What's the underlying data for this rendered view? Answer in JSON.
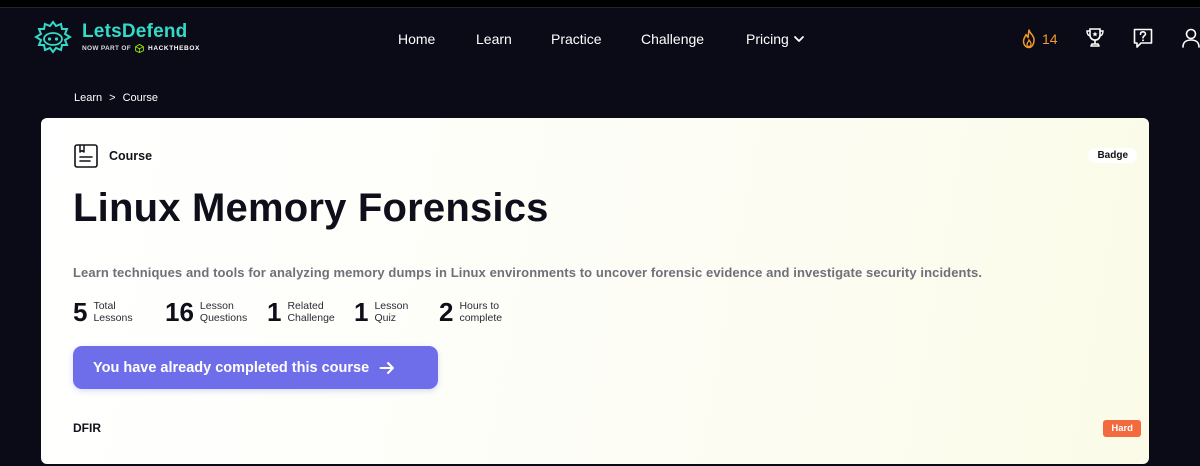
{
  "brand": {
    "name": "LetsDefend",
    "now_part_of": "NOW PART OF",
    "partner": "HACKTHEBOX",
    "color": "#34d9c8"
  },
  "nav": {
    "items": [
      {
        "label": "Home"
      },
      {
        "label": "Learn"
      },
      {
        "label": "Practice"
      },
      {
        "label": "Challenge"
      },
      {
        "label": "Pricing"
      }
    ]
  },
  "header": {
    "streak_count": "14",
    "streak_icon": "fire-icon",
    "icons": [
      "trophy-icon",
      "help-icon",
      "user-icon"
    ]
  },
  "breadcrumb": {
    "items": [
      "Learn",
      "Course"
    ],
    "separator": ">"
  },
  "course": {
    "type_label": "Course",
    "badge_label": "Badge",
    "title": "Linux Memory Forensics",
    "description": "Learn techniques and tools for analyzing memory dumps in Linux environments to uncover forensic evidence and investigate security incidents.",
    "stats": [
      {
        "value": "5",
        "line1": "Total",
        "line2": "Lessons"
      },
      {
        "value": "16",
        "line1": "Lesson",
        "line2": "Questions"
      },
      {
        "value": "1",
        "line1": "Related",
        "line2": "Challenge"
      },
      {
        "value": "1",
        "line1": "Lesson",
        "line2": "Quiz"
      },
      {
        "value": "2",
        "line1": "Hours to",
        "line2": "complete"
      }
    ],
    "cta_label": "You have already completed this course",
    "category": "DFIR",
    "difficulty": "Hard",
    "accent": "#6f6eea",
    "difficulty_color": "#f26a3d"
  }
}
